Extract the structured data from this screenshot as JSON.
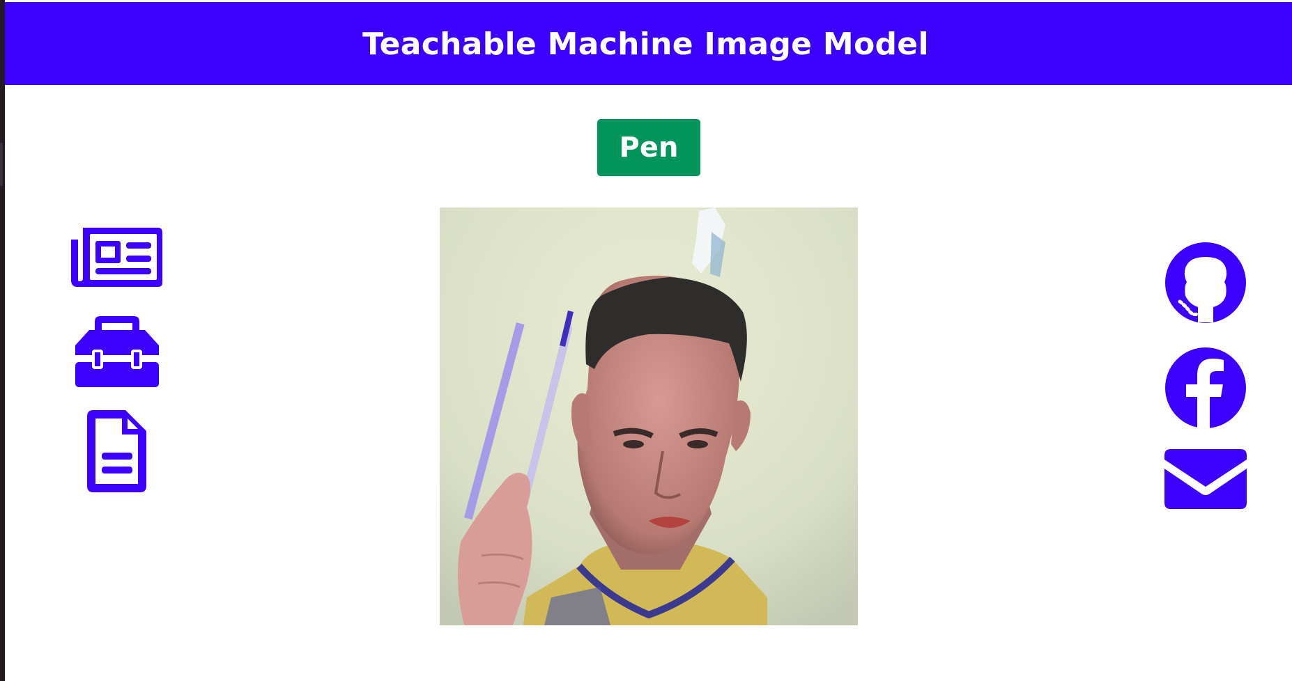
{
  "header": {
    "title": "Teachable Machine Image Model"
  },
  "prediction": {
    "label": "Pen",
    "color": "#01945b"
  },
  "theme": {
    "accent": "#3c00ff"
  },
  "webcam": {
    "subject": "webcam-feed"
  },
  "left_nav": {
    "icons": [
      "newspaper-icon",
      "toolbox-icon",
      "document-icon"
    ]
  },
  "right_nav": {
    "icons": [
      "github-icon",
      "facebook-icon",
      "envelope-icon"
    ]
  }
}
